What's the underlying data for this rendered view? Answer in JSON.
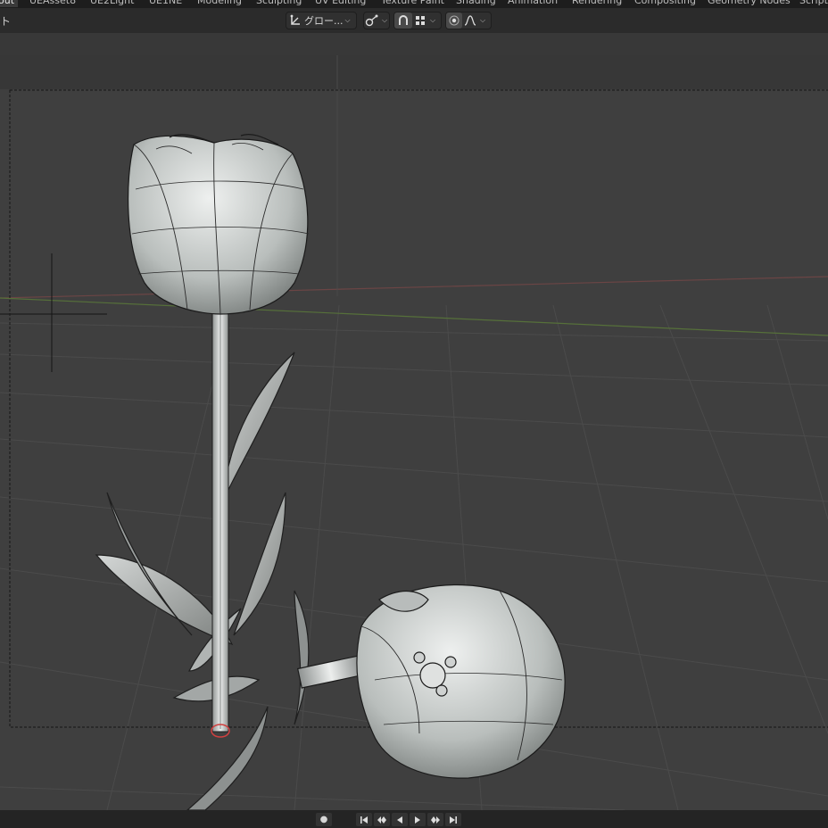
{
  "workspace_tabs": [
    {
      "label": "out",
      "active": true
    },
    {
      "label": "UEAsset8",
      "active": false
    },
    {
      "label": "UE2Light",
      "active": false
    },
    {
      "label": "UE1NE",
      "active": false
    },
    {
      "label": "Modeling",
      "active": false
    },
    {
      "label": "Sculpting",
      "active": false
    },
    {
      "label": "UV Editing",
      "active": false
    },
    {
      "label": "Texture Paint",
      "active": false
    },
    {
      "label": "Shading",
      "active": false
    },
    {
      "label": "Animation",
      "active": false
    },
    {
      "label": "Rendering",
      "active": false
    },
    {
      "label": "Compositing",
      "active": false
    },
    {
      "label": "Geometry Nodes",
      "active": false
    },
    {
      "label": "Scripti",
      "active": false
    }
  ],
  "header": {
    "left_label": "ト",
    "transform_orientation": "グロー...",
    "icons": {
      "orientation": "transform-orientation-icon",
      "pivot": "pivot-point-icon",
      "snap": "snap-magnet-icon",
      "snap_target": "snap-increment-icon",
      "proportional": "proportional-editing-icon",
      "falloff": "falloff-curve-icon"
    }
  },
  "timeline": {
    "icons": [
      "record-dot-icon",
      "jump-start-icon",
      "prev-keyframe-icon",
      "play-reverse-icon",
      "play-icon",
      "next-keyframe-icon",
      "jump-end-icon"
    ]
  },
  "colors": {
    "viewport_bg": "#3f3f3f",
    "header_bg": "#2b2b2b",
    "grid_line": "#4a4a4a",
    "x_axis": "#8a4a4a",
    "y_axis": "#5d7a3a",
    "mesh_fill": "#c9cccb",
    "mesh_wire": "#1c1c1c"
  }
}
